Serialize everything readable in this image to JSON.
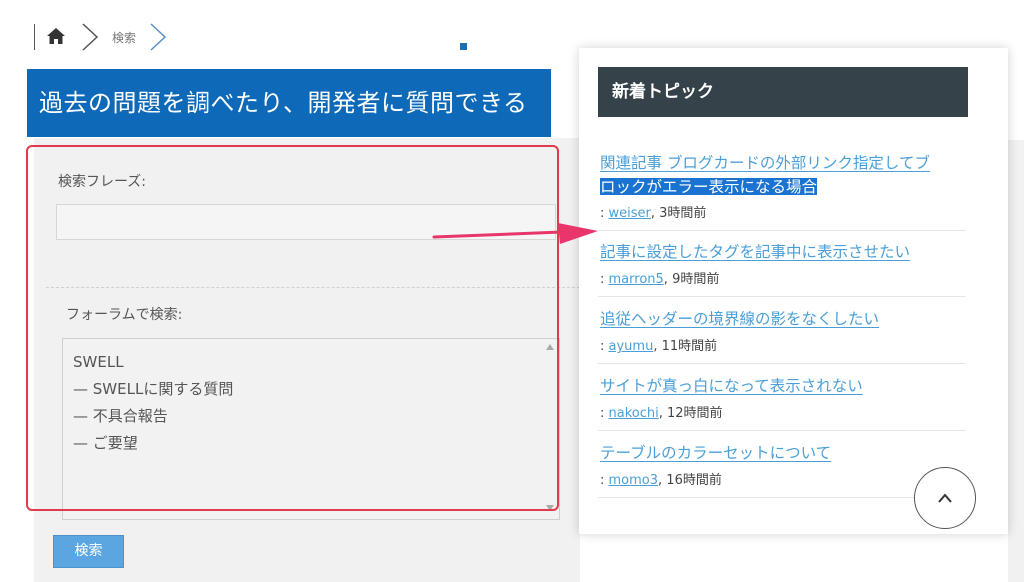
{
  "breadcrumb": {
    "current": "検索"
  },
  "banner": {
    "text": "過去の問題を調べたり、開発者に質問できる"
  },
  "search_form": {
    "phrase_label": "検索フレーズ:",
    "phrase_value": "",
    "forum_label": "フォーラムで検索:",
    "forum_options": [
      "SWELL",
      "— SWELLに関する質問",
      "— 不具合報告",
      "— ご要望"
    ],
    "button_label": "検索"
  },
  "topics": {
    "heading": "新着トピック",
    "items": [
      {
        "title_line1": "関連記事 ブログカードの外部リンク指定してブ",
        "title_line2": "ロックがエラー表示になる場合",
        "user": "weiser",
        "time": "3時間前"
      },
      {
        "title_line1": "記事に設定したタグを記事中に表示させたい",
        "user": "marron5",
        "time": "9時間前"
      },
      {
        "title_line1": "追従ヘッダーの境界線の影をなくしたい",
        "user": "ayumu",
        "time": "11時間前"
      },
      {
        "title_line1": "サイトが真っ白になって表示されない",
        "user": "nakochi",
        "time": "12時間前"
      },
      {
        "title_line1": "テーブルのカラーセットについて",
        "user": "momo3",
        "time": "16時間前"
      }
    ]
  },
  "colors": {
    "banner": "#0e6ab8",
    "link": "#4a9fd8",
    "panel_head": "#36424a",
    "highlight_box": "#e23a4c",
    "arrow": "#e8366a"
  },
  "icons": {
    "home": "home-icon",
    "up": "chevron-up-icon"
  }
}
